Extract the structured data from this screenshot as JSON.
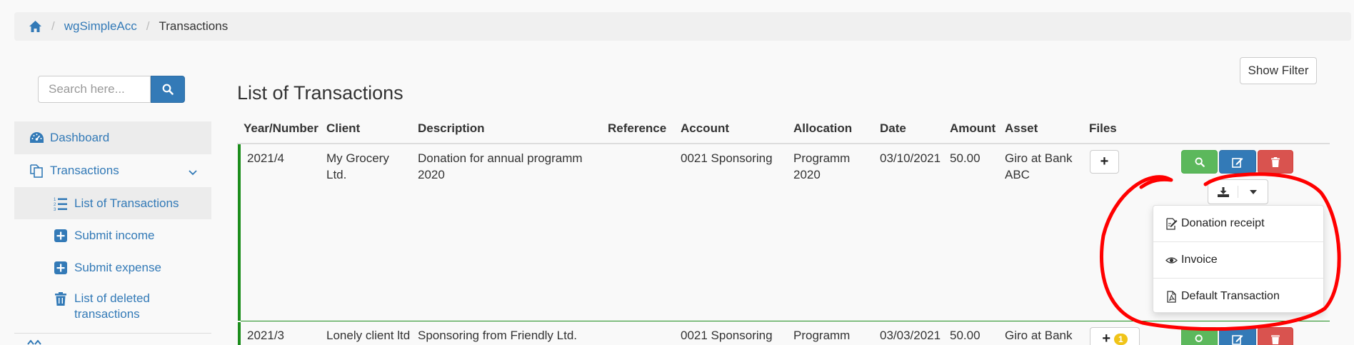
{
  "breadcrumb": {
    "home_icon": "home-icon",
    "app": "wgSimpleAcc",
    "current": "Transactions"
  },
  "search": {
    "placeholder": "Search here...",
    "icon": "search-icon"
  },
  "sidebar": {
    "items": [
      {
        "label": "Dashboard",
        "icon": "dashboard-icon"
      },
      {
        "label": "Transactions",
        "icon": "copy-icon"
      },
      {
        "label": "List of Transactions",
        "icon": "list-ol-icon"
      },
      {
        "label": "Submit income",
        "icon": "plus-square-icon"
      },
      {
        "label": "Submit expense",
        "icon": "plus-square-icon"
      },
      {
        "label": "List of deleted transactions",
        "icon": "trash-icon"
      }
    ]
  },
  "toolbar": {
    "show_filter_label": "Show Filter"
  },
  "main": {
    "title": "List of Transactions"
  },
  "table": {
    "columns": [
      "Year/Number",
      "Client",
      "Description",
      "Reference",
      "Account",
      "Allocation",
      "Date",
      "Amount",
      "Asset",
      "Files"
    ],
    "rows": [
      {
        "number": "2021/4",
        "client": "My Grocery Ltd.",
        "description": "Donation for annual programm 2020",
        "reference": "",
        "account": "0021 Sponsoring",
        "allocation": "Programm 2020",
        "date": "03/10/2021",
        "amount": "50.00",
        "asset": "Giro at Bank ABC",
        "files_label": "+",
        "files_count": ""
      },
      {
        "number": "2021/3",
        "client": "Lonely client ltd",
        "description": "Sponsoring from Friendly Ltd.",
        "reference": "",
        "account": "0021 Sponsoring",
        "allocation": "Programm",
        "date": "03/03/2021",
        "amount": "50.00",
        "asset": "Giro at Bank",
        "files_label": "+",
        "files_count": "1"
      }
    ]
  },
  "download_menu": {
    "items": [
      {
        "label": "Donation receipt",
        "icon": "edit-document-icon"
      },
      {
        "label": "Invoice",
        "icon": "eye-icon"
      },
      {
        "label": "Default Transaction",
        "icon": "pdf-file-icon"
      }
    ]
  },
  "colors": {
    "link": "#337ab7",
    "view_button": "#5cb85c",
    "edit_button": "#337ab7",
    "delete_button": "#d9534f",
    "row_marker": "#1c8d1c",
    "badge": "#f0c419",
    "annotation": "#ff0000"
  }
}
